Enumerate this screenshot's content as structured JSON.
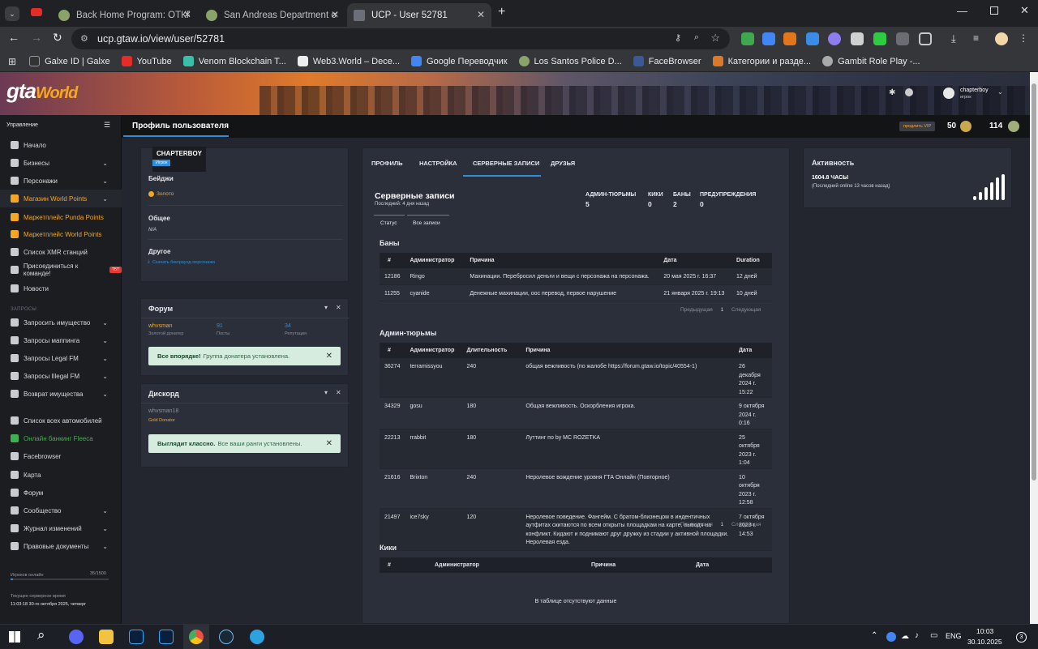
{
  "browser": {
    "tabs": [
      {
        "title": "Back Home Program: ОТКРЫТО"
      },
      {
        "title": "San Andreas Department of Co"
      },
      {
        "title": "UCP - User 52781"
      }
    ],
    "url": "ucp.gtaw.io/view/user/52781",
    "bookmarks": [
      "Galxe ID | Galxe",
      "YouTube",
      "Venom Blockchain T...",
      "Web3.World – Dece...",
      "Google Переводчик",
      "Los Santos Police D...",
      "FaceBrowser",
      "Категории и разде...",
      "Gambit Role Play -..."
    ]
  },
  "site": {
    "logo_main": "gta",
    "logo_accent": "World",
    "user": {
      "name": "chapterboy",
      "role": "игрок"
    },
    "header_title": "Профиль пользователя",
    "vip_label": "продлить VIP",
    "coins": "50",
    "points": "114",
    "sidebar_section_main": "Управление",
    "sidebar_main": [
      {
        "label": "Начало",
        "chev": false,
        "accent": false
      },
      {
        "label": "Бизнесы",
        "chev": true,
        "accent": false
      },
      {
        "label": "Персонажи",
        "chev": true,
        "accent": false
      },
      {
        "label": "Магазин World Points",
        "chev": true,
        "accent": true
      },
      {
        "label": "Маркетплейс Punda Points",
        "chev": false,
        "accent": true
      },
      {
        "label": "Маркетплейс World Points",
        "chev": false,
        "accent": true
      },
      {
        "label": "Список XMR станций",
        "chev": false,
        "accent": false
      },
      {
        "label": "Присоединиться к команде!",
        "chev": false,
        "accent": false,
        "badge": "ТБТ"
      },
      {
        "label": "Новости",
        "chev": false,
        "accent": false
      }
    ],
    "sidebar_section_req": "ЗАПРОСЫ",
    "sidebar_req": [
      {
        "label": "Запросить имущество",
        "chev": true
      },
      {
        "label": "Запросы маппинга",
        "chev": true
      },
      {
        "label": "Запросы Legal FM",
        "chev": true
      },
      {
        "label": "Запросы Illegal FM",
        "chev": true
      },
      {
        "label": "Возврат имущества",
        "chev": true
      }
    ],
    "sidebar_other": [
      {
        "label": "Список всех автомобилей",
        "chev": false,
        "green": false
      },
      {
        "label": "Онлайн банкинг Fleeca",
        "chev": false,
        "green": true
      },
      {
        "label": "Facebrowser",
        "chev": false,
        "green": false
      },
      {
        "label": "Карта",
        "chev": false,
        "green": false
      },
      {
        "label": "Форум",
        "chev": false,
        "green": false
      },
      {
        "label": "Сообщество",
        "chev": true,
        "green": false
      },
      {
        "label": "Журнал изменений",
        "chev": true,
        "green": false
      },
      {
        "label": "Правовые документы",
        "chev": true,
        "green": false
      }
    ],
    "players_online_label": "Игроков онлайн",
    "players_online_value": "35/1500",
    "players_online_fraction": 0.023,
    "server_time_label": "Текущее серверное время",
    "server_time_value": "11:03:18 30-го октября 2025, четверг"
  },
  "profile": {
    "name": "CHAPTERBOY",
    "role_badge": "Игрок",
    "badges_title": "Бейджи",
    "badge_gold": "Золото",
    "general_title": "Общее",
    "general_value": "N/A",
    "other_title": "Другое",
    "other_link": "Скачать бекграунд персонажа"
  },
  "forum": {
    "title": "Форум",
    "user": "whvsman",
    "user_sub": "Золотой донатер",
    "posts": "91",
    "posts_label": "Посты",
    "rep": "34",
    "rep_label": "Репутация",
    "alert_bold": "Все впорядке!",
    "alert_text": "Группа донатера установлена."
  },
  "discord": {
    "title": "Дискорд",
    "user": "whvsman18",
    "role": "Gold Donator",
    "alert_bold": "Выглядит классно.",
    "alert_text": "Все ваши ранги установлены."
  },
  "records": {
    "tabs": [
      "ПРОФИЛЬ",
      "НАСТРОЙКА",
      "СЕРВЕРНЫЕ ЗАПИСИ",
      "ДРУЗЬЯ"
    ],
    "title": "Серверные записи",
    "last": "Последний: 4 дня назад",
    "stats": [
      {
        "label": "АДМИН-ТЮРЬМЫ",
        "value": "5"
      },
      {
        "label": "КИКИ",
        "value": "0"
      },
      {
        "label": "БАНЫ",
        "value": "2"
      },
      {
        "label": "ПРЕДУПРЕЖДЕНИЯ",
        "value": "0"
      }
    ],
    "subtabs": [
      "Статус",
      "Все записи"
    ],
    "bans_title": "Баны",
    "bans_headers": [
      "#",
      "Администратор",
      "Причина",
      "Дата",
      "Duration"
    ],
    "bans_rows": [
      [
        "12186",
        "Ringo",
        "Махинации. Перебросил деньги и вещи с персонажа на персонажа.",
        "20 мая 2025 г. 16:37",
        "12 дней"
      ],
      [
        "11255",
        "cyanide",
        "Денежные махинации, оос перевод, первое нарушение",
        "21 января 2025 г. 19:13",
        "10 дней"
      ]
    ],
    "pager_prev": "Предыдущая",
    "pager_page": "1",
    "pager_next": "Следующая",
    "jail_title": "Админ-тюрьмы",
    "jail_headers": [
      "#",
      "Администратор",
      "Длительность",
      "Причина",
      "Дата"
    ],
    "jail_rows": [
      [
        "36274",
        "terramissyou",
        "240",
        "общая вежливость (по жалобе https://forum.gtaw.io/topic/40554-1)",
        "26 декабря 2024 г. 15:22"
      ],
      [
        "34329",
        "gosu",
        "180",
        "Общая вежливость. Оскорбления игрока.",
        "9 октября 2024 г. 0:16"
      ],
      [
        "22213",
        "rrabbit",
        "180",
        "Луттинг по by MC ROZETKA",
        "25 октября 2023 г. 1:04"
      ],
      [
        "21616",
        "Brixton",
        "240",
        "Неролевое вождение уровня ГТА Онлайн (Повторное)",
        "10 октября 2023 г. 12:58"
      ],
      [
        "21497",
        "ice7sky",
        "120",
        "Неролевое поведение. Фангейм. С братом-близнецом в индентичных аутфитах скитаются по всем открыты площадкам на карте, выводя на конфликт. Кидают и поднимают друг дружку из стадии у активной площадки. Неролевая езда.",
        "7 октября 2023 г. 14:53"
      ]
    ],
    "kicks_title": "Кики",
    "kicks_headers": [
      "#",
      "Администратор",
      "Причина",
      "Дата"
    ],
    "kicks_empty": "В таблице отсутствуют данные"
  },
  "activity": {
    "title": "Активность",
    "hours": "1604.8 ЧАСЫ",
    "last": "(Последний online 13 часов назад)"
  },
  "taskbar": {
    "lang": "ENG",
    "time": "10:03",
    "date": "30.10.2025",
    "notif": "3"
  },
  "colors": {
    "accent_orange": "#f5a623",
    "accent_blue": "#2f8fd8",
    "green": "#3fb04f",
    "alert_bg": "#d6ecdf"
  }
}
